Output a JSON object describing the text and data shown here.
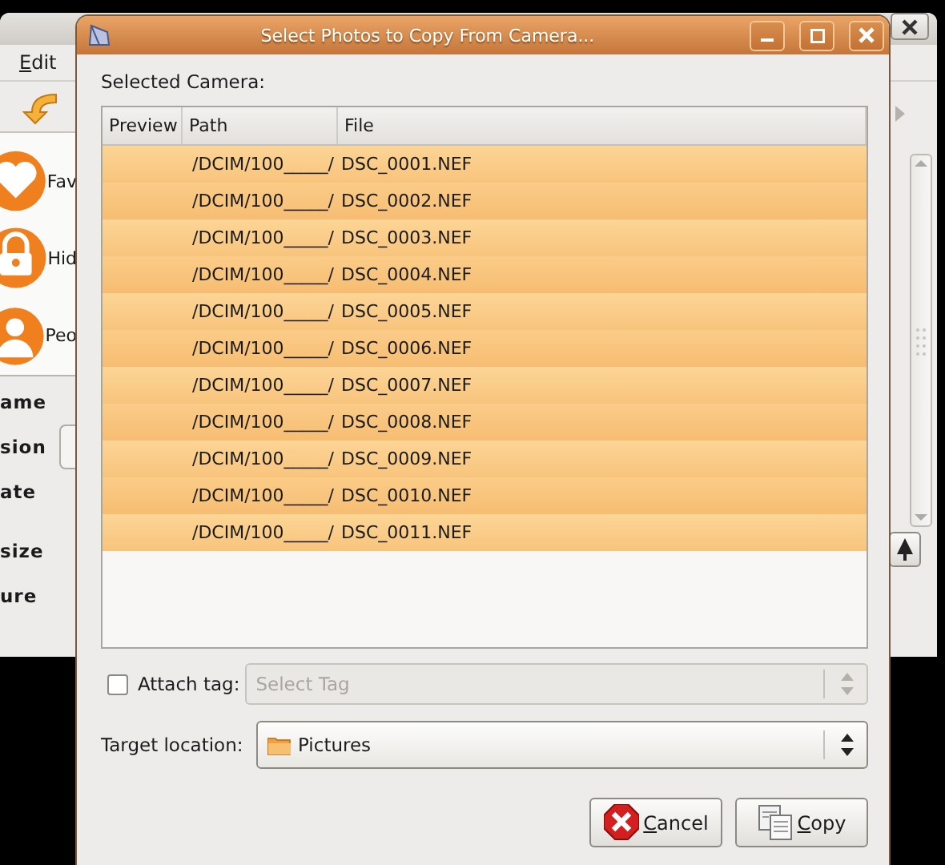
{
  "background_window": {
    "menu": [
      {
        "label": "Edit"
      }
    ],
    "sidebar": [
      {
        "label": "Fav",
        "kind": "heart"
      },
      {
        "label": "Hid",
        "kind": "lock"
      },
      {
        "label": "Peo",
        "kind": "person"
      }
    ],
    "properties": [
      {
        "label": "ame",
        "has_field": false
      },
      {
        "label": "sion",
        "has_field": true
      },
      {
        "label": "ate",
        "has_field": false
      },
      {
        "label": "size",
        "has_field": false
      },
      {
        "label": "ure",
        "has_field": false
      }
    ]
  },
  "dialog": {
    "title": "Select Photos to Copy From Camera...",
    "camera_label": "Selected Camera:",
    "table": {
      "columns": [
        "Preview",
        "Path",
        "File"
      ],
      "rows": [
        {
          "path": "/DCIM/100_____/",
          "file": "DSC_0001.NEF",
          "selected": true
        },
        {
          "path": "/DCIM/100_____/",
          "file": "DSC_0002.NEF",
          "selected": true
        },
        {
          "path": "/DCIM/100_____/",
          "file": "DSC_0003.NEF",
          "selected": true
        },
        {
          "path": "/DCIM/100_____/",
          "file": "DSC_0004.NEF",
          "selected": true
        },
        {
          "path": "/DCIM/100_____/",
          "file": "DSC_0005.NEF",
          "selected": true
        },
        {
          "path": "/DCIM/100_____/",
          "file": "DSC_0006.NEF",
          "selected": true
        },
        {
          "path": "/DCIM/100_____/",
          "file": "DSC_0007.NEF",
          "selected": true
        },
        {
          "path": "/DCIM/100_____/",
          "file": "DSC_0008.NEF",
          "selected": true
        },
        {
          "path": "/DCIM/100_____/",
          "file": "DSC_0009.NEF",
          "selected": true
        },
        {
          "path": "/DCIM/100_____/",
          "file": "DSC_0010.NEF",
          "selected": true
        },
        {
          "path": "/DCIM/100_____/",
          "file": "DSC_0011.NEF",
          "selected": true
        }
      ]
    },
    "attach_tag": {
      "label": "Attach tag:",
      "checked": false,
      "placeholder": "Select Tag",
      "disabled": true
    },
    "target_location": {
      "label": "Target location:",
      "value": "Pictures"
    },
    "buttons": [
      {
        "label": "Cancel",
        "kind": "cancel"
      },
      {
        "label": "Copy",
        "kind": "copy"
      }
    ]
  }
}
